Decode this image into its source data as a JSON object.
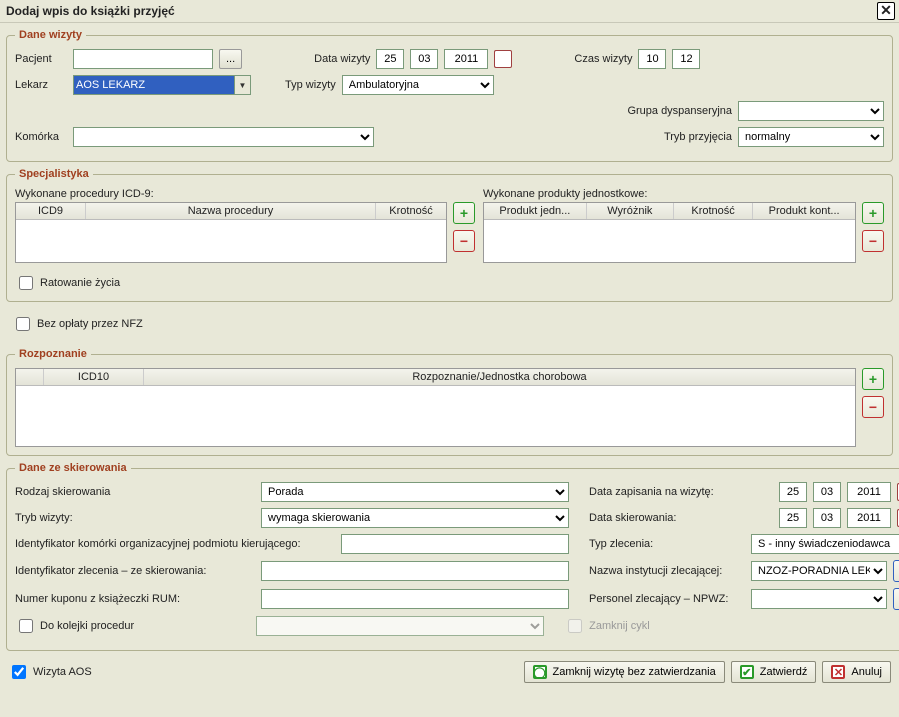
{
  "title": "Dodaj wpis do książki przyjęć",
  "visit": {
    "legend": "Dane wizyty",
    "patient_label": "Pacjent",
    "patient_value": "",
    "patient_browse": "...",
    "date_label": "Data wizyty",
    "date_day": "25",
    "date_month": "03",
    "date_year": "2011",
    "time_label": "Czas wizyty",
    "time_h": "10",
    "time_m": "12",
    "doctor_label": "Lekarz",
    "doctor_value": "AOS LEKARZ",
    "type_label": "Typ wizyty",
    "type_value": "Ambulatoryjna",
    "group_label": "Grupa dyspanseryjna",
    "group_value": "",
    "cell_label": "Komórka",
    "cell_value": "",
    "admission_label": "Tryb przyjęcia",
    "admission_value": "normalny"
  },
  "spec": {
    "legend": "Specjalistyka",
    "icd9_caption": "Wykonane procedury ICD-9:",
    "icd9_cols": [
      "ICD9",
      "Nazwa procedury",
      "Krotność"
    ],
    "units_caption": "Wykonane produkty jednostkowe:",
    "units_cols": [
      "Produkt jedn...",
      "Wyróżnik",
      "Krotność",
      "Produkt kont..."
    ],
    "rescue_label": "Ratowanie życia"
  },
  "nfzfree_label": "Bez opłaty przez NFZ",
  "diag": {
    "legend": "Rozpoznanie",
    "cols": [
      "ICD10",
      "Rozpoznanie/Jednostka chorobowa"
    ]
  },
  "ref": {
    "legend": "Dane ze skierowania",
    "kind_label": "Rodzaj skierowania",
    "kind_value": "Porada",
    "savedate_label": "Data zapisania na wizytę:",
    "savedate": {
      "d": "25",
      "m": "03",
      "y": "2011"
    },
    "mode_label": "Tryb wizyty:",
    "mode_value": "wymaga skierowania",
    "refdate_label": "Data skierowania:",
    "refdate": {
      "d": "25",
      "m": "03",
      "y": "2011"
    },
    "orgid_label": "Identyfikator komórki organizacyjnej podmiotu kierującego:",
    "orgid_value": "",
    "order_type_label": "Typ zlecenia:",
    "order_type_value": "S - inny świadczeniodawca",
    "order_id_label": "Identyfikator zlecenia – ze skierowania:",
    "order_id_value": "",
    "institution_label": "Nazwa instytucji zlecającej:",
    "institution_value": "NZOZ-PORADNIA LEK",
    "coupon_label": "Numer kuponu z książeczki RUM:",
    "coupon_value": "",
    "npwz_label": "Personel zlecający – NPWZ:",
    "npwz_value": "",
    "queue_label": "Do kolejki procedur",
    "close_cycle_label": "Zamknij cykl"
  },
  "footer": {
    "aos_label": "Wizyta AOS",
    "close_noconfirm": "Zamknij wizytę bez zatwierdzania",
    "confirm": "Zatwierdź",
    "cancel": "Anuluj"
  }
}
